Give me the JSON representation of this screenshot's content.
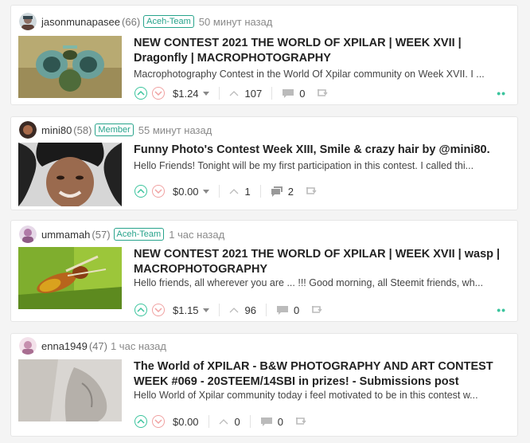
{
  "colors": {
    "accent": "#3bc49d",
    "downvote": "#f0a1a1",
    "badge": "#27a38b"
  },
  "posts": [
    {
      "author": "jasonmunapasee",
      "reputation": "(66)",
      "badge": "Aceh-Team",
      "time": "50 минут назад",
      "title": "NEW CONTEST 2021 THE WORLD OF XPILAR | WEEK XVII | Dragonfly | MACROPHOTOGRAPHY",
      "excerpt": "Macrophotography Contest in the World Of Xpilar community on Week XVII. I ...",
      "payout": "$1.24",
      "votes": "107",
      "comments": "0",
      "thumb_icon": "dragonfly-photo"
    },
    {
      "author": "mini80",
      "reputation": "(58)",
      "badge": "Member",
      "time": "55 минут назад",
      "title": "Funny Photo's Contest Week XIII, Smile & crazy hair by @mini80.",
      "excerpt": "Hello Friends! Tonight will be my first participation in this contest. I called thi...",
      "payout": "$0.00",
      "votes": "1",
      "comments": "2",
      "thumb_icon": "portrait-photo"
    },
    {
      "author": "ummamah",
      "reputation": "(57)",
      "badge": "Aceh-Team",
      "time": "1 час назад",
      "title": "NEW CONTEST 2021 THE WORLD OF XPILAR | WEEK XVII | wasp | MACROPHOTOGRAPHY",
      "excerpt": "Hello friends, all wherever you are ... !!! Good morning, all Steemit friends, wh...",
      "payout": "$1.15",
      "votes": "96",
      "comments": "0",
      "thumb_icon": "wasp-photo"
    },
    {
      "author": "enna1949",
      "reputation": "(47)",
      "time": "1 час назад",
      "title": "The World of XPILAR - B&W PHOTOGRAPHY AND ART CONTEST WEEK #069 - 20STEEM/14SBI in prizes! - Submissions post",
      "excerpt": "Hello World of Xpilar community today i feel motivated to be in this contest w...",
      "payout": "$0.00",
      "votes": "0",
      "comments": "0",
      "thumb_icon": "bw-photo"
    }
  ]
}
